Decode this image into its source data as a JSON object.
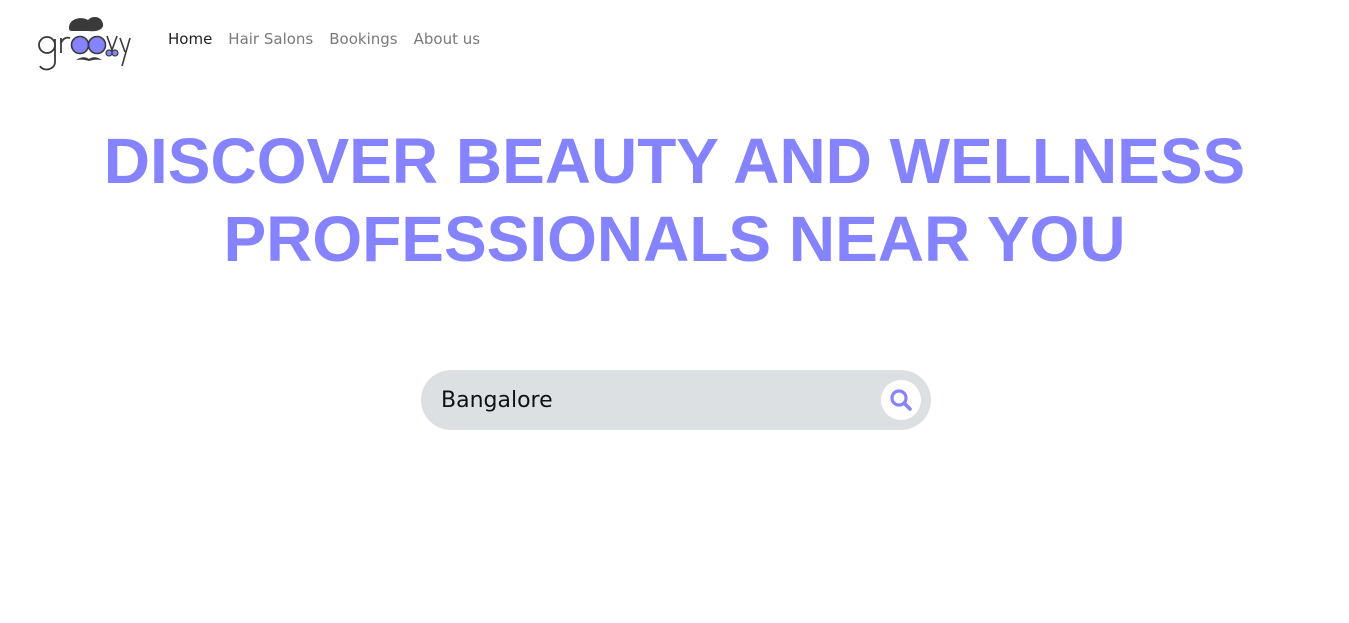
{
  "brand": {
    "logo_text": "groovy",
    "accent_color": "#8583ff",
    "dark_color": "#3a3a3a"
  },
  "nav": {
    "items": [
      {
        "label": "Home",
        "active": true
      },
      {
        "label": "Hair Salons",
        "active": false
      },
      {
        "label": "Bookings",
        "active": false
      },
      {
        "label": "About us",
        "active": false
      }
    ]
  },
  "hero": {
    "line1": "DISCOVER BEAUTY AND WELLNESS",
    "line2": "PROFESSIONALS NEAR YOU"
  },
  "search": {
    "value": "Bangalore",
    "icon": "search-icon"
  }
}
